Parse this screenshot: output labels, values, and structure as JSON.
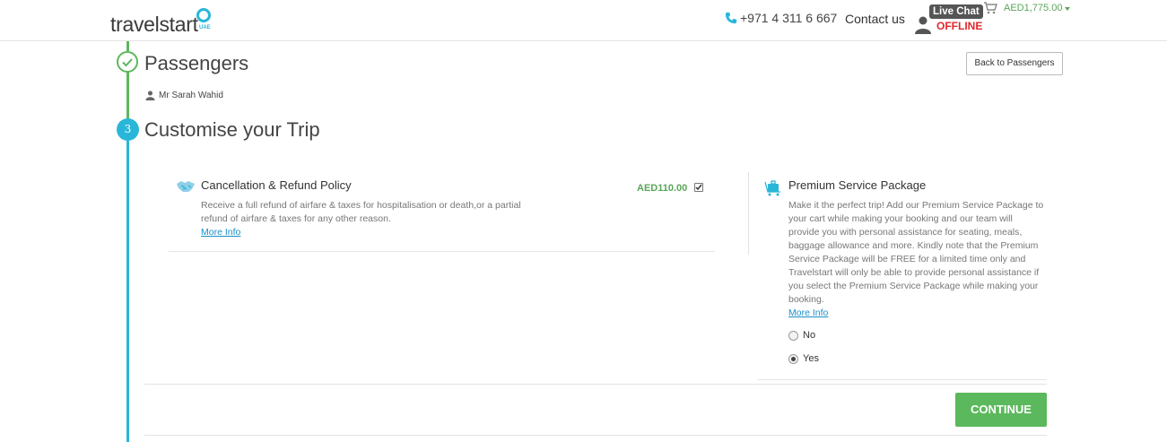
{
  "header": {
    "logo_text": "travelstart",
    "logo_sub": "UAE",
    "phone": "+971 4 311 6 667",
    "contact_label": "Contact us",
    "chat_label": "Live Chat",
    "chat_status": "OFFLINE",
    "cart_amount": "AED1,775.00"
  },
  "steps": {
    "passengers": {
      "title": "Passengers",
      "back_label": "Back to Passengers",
      "passenger_name": "Mr Sarah Wahid"
    },
    "customise": {
      "number": "3",
      "title": "Customise your Trip"
    }
  },
  "cancellation": {
    "title": "Cancellation & Refund Policy",
    "price": "AED110.00",
    "checked": true,
    "description": "Receive a full refund of airfare & taxes for hospitalisation or death,or a partial refund of airfare & taxes for any other reason.",
    "more_info": "More Info"
  },
  "premium": {
    "title": "Premium Service Package",
    "description": "Make it the perfect trip! Add our Premium Service Package to your cart while making your booking and our team will provide you with personal assistance for seating, meals, baggage allowance and more. Kindly note that the Premium Service Package will be FREE for a limited time only and Travelstart will only be able to provide personal assistance if you select the Premium Service Package while making your booking.",
    "more_info": "More Info",
    "options": [
      {
        "label": "No",
        "selected": false
      },
      {
        "label": "Yes",
        "selected": true
      }
    ]
  },
  "actions": {
    "continue_label": "CONTINUE"
  },
  "colors": {
    "accent_green": "#5cb85c",
    "accent_blue": "#29b6d9",
    "link": "#1a8fc8",
    "offline_red": "#e0282d"
  }
}
